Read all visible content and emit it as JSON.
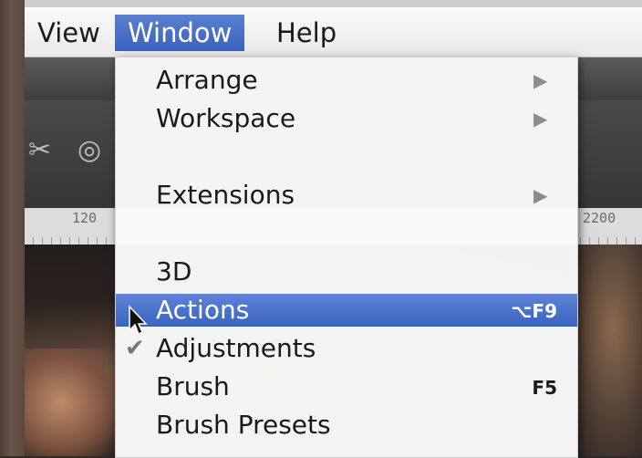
{
  "menubar": {
    "items": [
      {
        "label": "View"
      },
      {
        "label": "Window"
      },
      {
        "label": "Help"
      }
    ]
  },
  "ruler": {
    "left_label": "120",
    "right_label": "2200"
  },
  "window_menu": {
    "items": [
      {
        "label": "Arrange",
        "has_submenu": true
      },
      {
        "label": "Workspace",
        "has_submenu": true
      },
      {
        "label": "Extensions",
        "has_submenu": true
      },
      {
        "label": "3D"
      },
      {
        "label": "Actions",
        "shortcut": "⌥F9",
        "highlighted": true
      },
      {
        "label": "Adjustments",
        "checked": true
      },
      {
        "label": "Brush",
        "shortcut": "F5"
      },
      {
        "label": "Brush Presets"
      }
    ]
  },
  "icons": {
    "submenu": "triangle-right-icon",
    "check": "checkmark-icon",
    "cursor": "arrow-cursor-icon",
    "tool_left": "scissors-icon",
    "tool_right": "target-brush-icon"
  },
  "colors": {
    "menu_highlight": "#3a62c0",
    "menubar_bg": "#f2f2f2"
  }
}
